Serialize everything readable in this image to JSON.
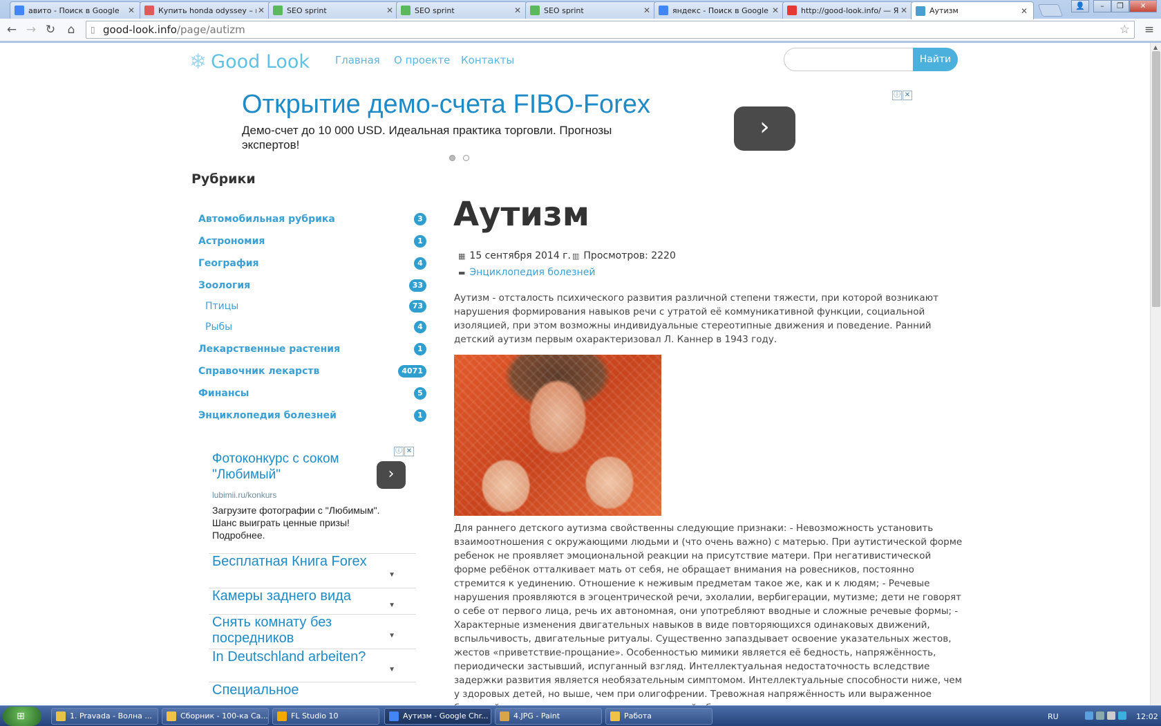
{
  "browser": {
    "tabs": [
      {
        "label": "авито - Поиск в Google",
        "icon": "google-icon",
        "color": "#4285f4"
      },
      {
        "label": "Купить honda odyssey – п",
        "icon": "honda-icon",
        "color": "#e05a5a"
      },
      {
        "label": "SEO sprint",
        "icon": "seosprint-icon",
        "color": "#5cb85c"
      },
      {
        "label": "SEO sprint",
        "icon": "seosprint-icon",
        "color": "#5cb85c"
      },
      {
        "label": "SEO sprint",
        "icon": "seosprint-icon",
        "color": "#5cb85c"
      },
      {
        "label": "яндекс - Поиск в Google",
        "icon": "google-icon",
        "color": "#4285f4"
      },
      {
        "label": "http://good-look.info/ — Ян",
        "icon": "yandex-icon",
        "color": "#e53935"
      },
      {
        "label": "Аутизм",
        "icon": "goodlook-icon",
        "color": "#4a9fd0",
        "active": true
      }
    ],
    "url_host": "good-look.info",
    "url_path": "/page/autizm"
  },
  "site": {
    "logo_text": "Good Look",
    "nav": [
      "Главная",
      "О проекте",
      "Контакты"
    ],
    "search_placeholder": "",
    "search_button": "Найти"
  },
  "ad_top": {
    "title": "Открытие демо-счета FIBO-Forex",
    "text": "Демо-счет до 10 000 USD. Идеальная практика торговли. Прогнозы экспертов!",
    "arrow": "›"
  },
  "sidebar": {
    "title": "Рубрики",
    "categories": [
      {
        "label": "Автомобильная рубрика",
        "count": "3"
      },
      {
        "label": "Астрономия",
        "count": "1"
      },
      {
        "label": "География",
        "count": "4"
      },
      {
        "label": "Зоология",
        "count": "33"
      },
      {
        "label": "Птицы",
        "count": "73",
        "sub": true
      },
      {
        "label": "Рыбы",
        "count": "4",
        "sub": true
      },
      {
        "label": "Лекарственные растения",
        "count": "1"
      },
      {
        "label": "Справочник лекарств",
        "count": "4071"
      },
      {
        "label": "Финансы",
        "count": "5"
      },
      {
        "label": "Энциклопедия болезней",
        "count": "1"
      }
    ]
  },
  "side_ad": {
    "title": "Фотоконкурс с соком \"Любимый\"",
    "url": "lubimii.ru/konkurs",
    "text": "Загрузите фотографии с \"Любимым\". Шанс выиграть ценные призы! Подробнее.",
    "links": [
      "Бесплатная Книга Forex",
      "Камеры заднего вида",
      "Снять комнату без посредников",
      "In Deutschland arbeiten?",
      "Специальное"
    ]
  },
  "article": {
    "title": "Аутизм",
    "date": "15 сентября 2014 г.",
    "views": "Просмотров: 2220",
    "category": "Энциклопедия болезней",
    "intro": "Аутизм - отсталость психического развития различной степени тяжести, при которой возникают нарушения формирования навыков речи с утратой её коммуникативной функции, социальной изоляцией, при этом возможны индивидуальные стереотипные движения и поведение. Ранний детский аутизм первым охарактеризовал Л. Каннер в 1943 году.",
    "body": "Для раннего детского аутизма свойственны следующие признаки: - Невозможность установить взаимоотношения с окружающими людьми и (что очень важно) с матерью. При аутистической форме ребенок не проявляет эмоциональной реакции на присутствие матери. При негативистической форме ребёнок отталкивает мать от себя, не обращает внимания на ровесников, постоянно стремится к уединению. Отношение к неживым предметам такое же, как и к людям; - Речевые нарушения проявляются в эгоцентрической речи, эхолалии, вербигерации, мутизме; дети не говорят о себе от первого лица, речь их автономная, они употребляют вводные и сложные речевые формы; - Характерные изменения двигательных навыков в виде повторяющихся одинаковых движений, вспыльчивость, двигательные ритуалы. Существенно запаздывает освоение указательных жестов, жестов «приветствие-прощание». Особенностью мимики является её бедность, напряжённость, периодически застывший, испуганный взгляд. Интеллектуальная недостаточность вследствие задержки развития является необязательным симптомом. Интеллектуальные способности ниже, чем у здоровых детей, но выше, чем при олигофрении. Тревожная напряжённость или выраженное беспокойство при попытке поменять привычный образ жизни, расположение предметов в"
  },
  "taskbar": {
    "items": [
      {
        "label": "1. Pravada  - Волна ...",
        "color": "#e8c34a"
      },
      {
        "label": "Сборник - 100-ка Са...",
        "color": "#f0c24a"
      },
      {
        "label": "FL Studio 10",
        "color": "#f2a900"
      },
      {
        "label": "Аутизм - Google Chr...",
        "color": "#4285f4",
        "active": true
      },
      {
        "label": "4.JPG - Paint",
        "color": "#d9a54a"
      },
      {
        "label": "Работа",
        "color": "#f0c24a"
      }
    ],
    "lang": "RU",
    "time": "12:02"
  }
}
